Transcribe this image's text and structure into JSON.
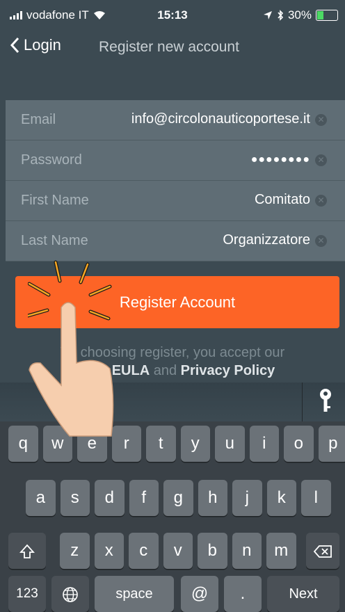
{
  "status_bar": {
    "carrier": "vodafone IT",
    "time": "15:13",
    "battery": "30%",
    "battery_level": 0.3
  },
  "nav": {
    "back_label": "Login",
    "title": "Register new account"
  },
  "form": {
    "fields": [
      {
        "label": "Email",
        "value": "info@circolonauticoportese.it"
      },
      {
        "label": "Password",
        "value": "●●●●●●●●"
      },
      {
        "label": "First Name",
        "value": "Comitato"
      },
      {
        "label": "Last Name",
        "value": "Organizzatore"
      }
    ]
  },
  "register_button": "Register Account",
  "legal": {
    "line1": "Wi choosing register, you accept our",
    "eula": "EULA",
    "and": "and",
    "privacy": "Privacy Policy"
  },
  "keyboard": {
    "row1": [
      "q",
      "w",
      "e",
      "r",
      "t",
      "y",
      "u",
      "i",
      "o",
      "p"
    ],
    "row2": [
      "a",
      "s",
      "d",
      "f",
      "g",
      "h",
      "j",
      "k",
      "l"
    ],
    "row3": [
      "z",
      "x",
      "c",
      "v",
      "b",
      "n",
      "m"
    ],
    "num_key": "123",
    "space_key": "space",
    "at_key": "@",
    "dot_key": ".",
    "next_key": "Next"
  },
  "colors": {
    "accent": "#fd6426",
    "background": "#3c4a52",
    "field_bg": "#5f6d75"
  },
  "icons": [
    "back-chevron-icon",
    "wifi-icon",
    "location-icon",
    "bluetooth-icon",
    "battery-icon",
    "clear-icon",
    "key-icon",
    "shift-icon",
    "backspace-icon",
    "globe-icon",
    "tap-hand-icon"
  ]
}
